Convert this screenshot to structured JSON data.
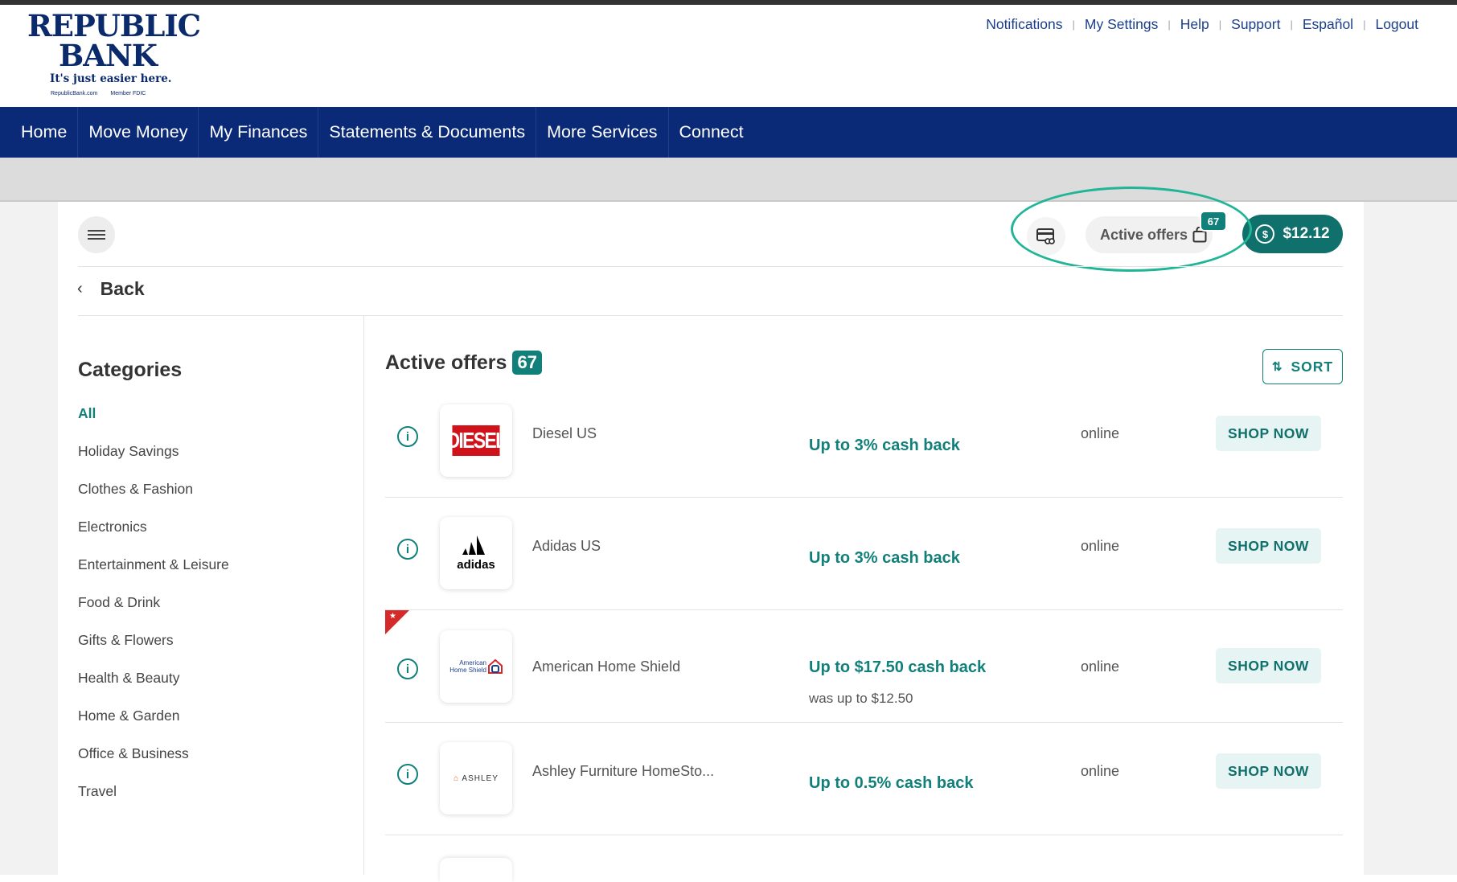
{
  "brand": {
    "line1": "REPUBLIC",
    "line2": "BANK",
    "tagline": "It's just easier here.",
    "fine_left": "RepublicBank.com",
    "fine_right": "Member FDIC"
  },
  "top_links": [
    "Notifications",
    "My Settings",
    "Help",
    "Support",
    "Español",
    "Logout"
  ],
  "nav": [
    "Home",
    "Move Money",
    "My Finances",
    "Statements & Documents",
    "More Services",
    "Connect"
  ],
  "toolbar": {
    "active_offers_label": "Active offers",
    "active_offers_count": "67",
    "balance": "$12.12"
  },
  "back_label": "Back",
  "categories": {
    "title": "Categories",
    "items": [
      "All",
      "Holiday Savings",
      "Clothes & Fashion",
      "Electronics",
      "Entertainment & Leisure",
      "Food & Drink",
      "Gifts & Flowers",
      "Health & Beauty",
      "Home & Garden",
      "Office & Business",
      "Travel"
    ],
    "active": "All"
  },
  "offers": {
    "title": "Active offers",
    "count": "67",
    "sort_label": "SORT",
    "shop_label": "SHOP NOW",
    "rows": [
      {
        "merchant": "Diesel US",
        "cash": "Up to 3% cash back",
        "was": "",
        "channel": "online",
        "logo_text": "DIESEL",
        "icon": "diesel-logo"
      },
      {
        "merchant": "Adidas US",
        "cash": "Up to 3% cash back",
        "was": "",
        "channel": "online",
        "logo_text": "adidas",
        "icon": "adidas-logo"
      },
      {
        "merchant": "American Home Shield",
        "cash": "Up to $17.50 cash back",
        "was": "was up to $12.50",
        "channel": "online",
        "logo_text": "American Home Shield",
        "icon": "american-home-shield-logo",
        "flag": true
      },
      {
        "merchant": "Ashley Furniture HomeSto...",
        "cash": "Up to 0.5% cash back",
        "was": "",
        "channel": "online",
        "logo_text": "ASHLEY",
        "icon": "ashley-logo"
      }
    ]
  },
  "colors": {
    "brand_navy": "#0a2a78",
    "accent_teal": "#12807a",
    "highlight_ring": "#20b596",
    "new_flag": "#d42a2a"
  }
}
